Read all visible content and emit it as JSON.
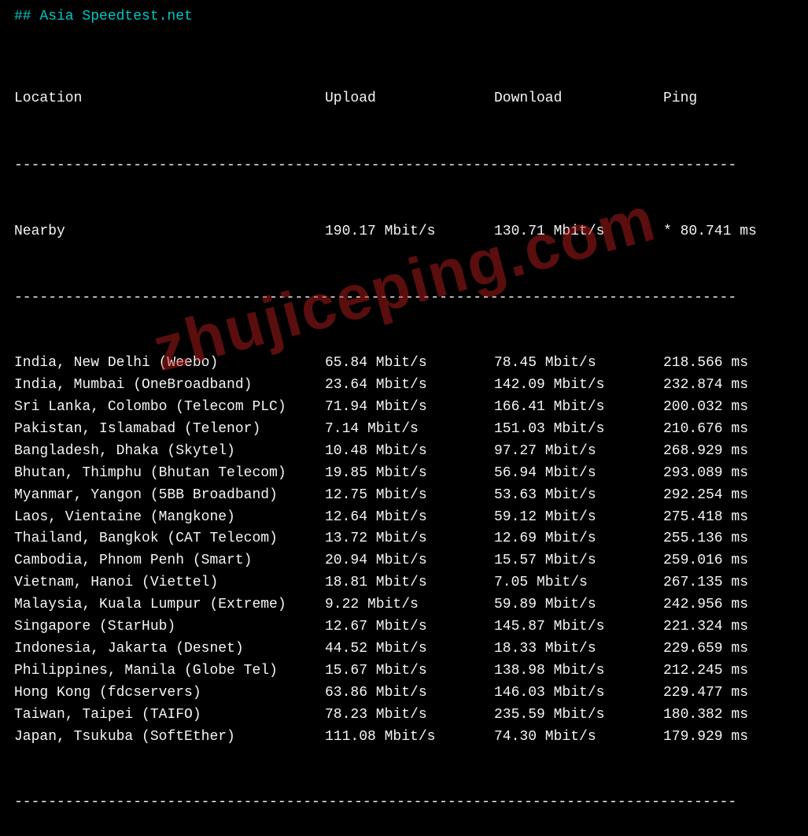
{
  "title": "## Asia Speedtest.net",
  "headers": {
    "location": "Location",
    "upload": "Upload",
    "download": "Download",
    "ping": "Ping"
  },
  "divider": "-------------------------------------------------------------------------------------",
  "nearby": {
    "location": "Nearby",
    "upload": "190.17 Mbit/s",
    "download": "130.71 Mbit/s",
    "ping": "* 80.741 ms"
  },
  "rows": [
    {
      "location": "India, New Delhi (Weebo)",
      "upload": "65.84 Mbit/s",
      "download": "78.45 Mbit/s",
      "ping": "218.566 ms"
    },
    {
      "location": "India, Mumbai (OneBroadband)",
      "upload": "23.64 Mbit/s",
      "download": "142.09 Mbit/s",
      "ping": "232.874 ms"
    },
    {
      "location": "Sri Lanka, Colombo (Telecom PLC)",
      "upload": "71.94 Mbit/s",
      "download": "166.41 Mbit/s",
      "ping": "200.032 ms"
    },
    {
      "location": "Pakistan, Islamabad (Telenor)",
      "upload": "7.14 Mbit/s",
      "download": "151.03 Mbit/s",
      "ping": "210.676 ms"
    },
    {
      "location": "Bangladesh, Dhaka (Skytel)",
      "upload": "10.48 Mbit/s",
      "download": "97.27 Mbit/s",
      "ping": "268.929 ms"
    },
    {
      "location": "Bhutan, Thimphu (Bhutan Telecom)",
      "upload": "19.85 Mbit/s",
      "download": "56.94 Mbit/s",
      "ping": "293.089 ms"
    },
    {
      "location": "Myanmar, Yangon (5BB Broadband)",
      "upload": "12.75 Mbit/s",
      "download": "53.63 Mbit/s",
      "ping": "292.254 ms"
    },
    {
      "location": "Laos, Vientaine (Mangkone)",
      "upload": "12.64 Mbit/s",
      "download": "59.12 Mbit/s",
      "ping": "275.418 ms"
    },
    {
      "location": "Thailand, Bangkok (CAT Telecom)",
      "upload": "13.72 Mbit/s",
      "download": "12.69 Mbit/s",
      "ping": "255.136 ms"
    },
    {
      "location": "Cambodia, Phnom Penh (Smart)",
      "upload": "20.94 Mbit/s",
      "download": "15.57 Mbit/s",
      "ping": "259.016 ms"
    },
    {
      "location": "Vietnam, Hanoi (Viettel)",
      "upload": "18.81 Mbit/s",
      "download": "7.05 Mbit/s",
      "ping": "267.135 ms"
    },
    {
      "location": "Malaysia, Kuala Lumpur (Extreme)",
      "upload": "9.22 Mbit/s",
      "download": "59.89 Mbit/s",
      "ping": "242.956 ms"
    },
    {
      "location": "Singapore (StarHub)",
      "upload": "12.67 Mbit/s",
      "download": "145.87 Mbit/s",
      "ping": "221.324 ms"
    },
    {
      "location": "Indonesia, Jakarta (Desnet)",
      "upload": "44.52 Mbit/s",
      "download": "18.33 Mbit/s",
      "ping": "229.659 ms"
    },
    {
      "location": "Philippines, Manila (Globe Tel)",
      "upload": "15.67 Mbit/s",
      "download": "138.98 Mbit/s",
      "ping": "212.245 ms"
    },
    {
      "location": "Hong Kong (fdcservers)",
      "upload": "63.86 Mbit/s",
      "download": "146.03 Mbit/s",
      "ping": "229.477 ms"
    },
    {
      "location": "Taiwan, Taipei (TAIFO)",
      "upload": "78.23 Mbit/s",
      "download": "235.59 Mbit/s",
      "ping": "180.382 ms"
    },
    {
      "location": "Japan, Tsukuba (SoftEther)",
      "upload": "111.08 Mbit/s",
      "download": "74.30 Mbit/s",
      "ping": "179.929 ms"
    }
  ],
  "watermark": "zhujiceping.com"
}
